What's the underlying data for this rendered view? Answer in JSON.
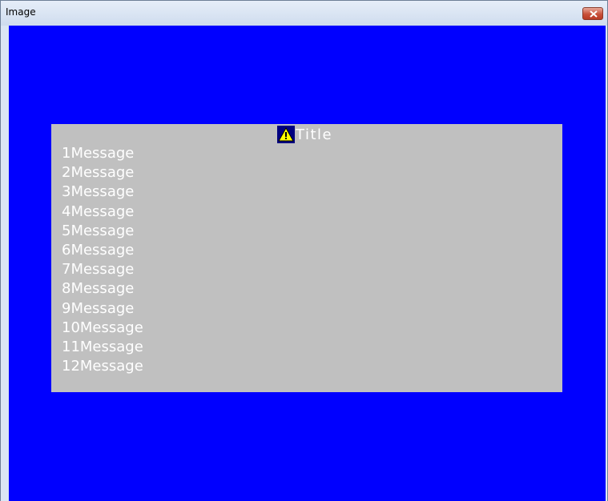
{
  "window": {
    "title": "Image",
    "close_icon": "close-icon"
  },
  "dialog": {
    "icon": "warning-icon",
    "title": "Title",
    "messages": [
      "1Message",
      "2Message",
      "3Message",
      "4Message",
      "5Message",
      "6Message",
      "7Message",
      "8Message",
      "9Message",
      "10Message",
      "11Message",
      "12Message"
    ]
  },
  "colors": {
    "background": "#0000ff",
    "dialog": "#c0c0c0",
    "text": "#ffffff",
    "icon_bg": "#000080",
    "icon_fill": "#ffff00"
  }
}
